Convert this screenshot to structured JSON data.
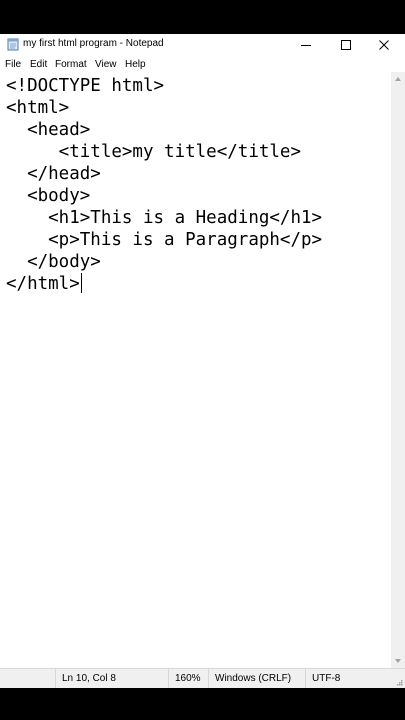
{
  "window": {
    "title": "my first html program - Notepad",
    "icon": "notepad-icon",
    "controls": [
      "minimize-icon",
      "maximize-icon",
      "close-icon"
    ]
  },
  "menu": {
    "file": "File",
    "edit": "Edit",
    "format": "Format",
    "view": "View",
    "help": "Help"
  },
  "editor": {
    "lines": [
      "<!DOCTYPE html>",
      "<html>",
      "  <head>",
      "     <title>my title</title>",
      "  </head>",
      "  <body>",
      "    <h1>This is a Heading</h1>",
      "    <p>This is a Paragraph</p>",
      "  </body>",
      "</html>"
    ]
  },
  "status": {
    "position": "Ln 10, Col 8",
    "zoom": "160%",
    "line_ending": "Windows (CRLF)",
    "encoding": "UTF-8"
  },
  "colors": {
    "background": "#ffffff",
    "statusbar": "#f0f0f0",
    "letterbox": "#000000"
  }
}
